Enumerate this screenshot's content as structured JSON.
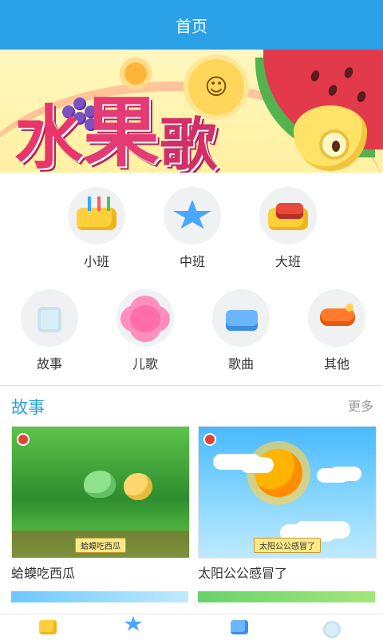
{
  "header": {
    "title": "首页"
  },
  "banner": {
    "text_parts": [
      "水",
      "果",
      "歌"
    ]
  },
  "categories": [
    {
      "label": "小班",
      "icon": "cheese-icon"
    },
    {
      "label": "中班",
      "icon": "star-icon"
    },
    {
      "label": "大班",
      "icon": "cheese-roll-icon"
    },
    {
      "label": "故事",
      "icon": "cup-icon"
    },
    {
      "label": "儿歌",
      "icon": "flower-icon"
    },
    {
      "label": "歌曲",
      "icon": "piano-icon"
    },
    {
      "label": "其他",
      "icon": "plane-icon"
    }
  ],
  "stories_section": {
    "title": "故事",
    "more": "更多"
  },
  "stories": [
    {
      "title": "蛤蟆吃西瓜",
      "caption": "蛤蟆吃西瓜"
    },
    {
      "title": "太阳公公感冒了",
      "caption": "太阳公公感冒了"
    }
  ],
  "colors": {
    "accent": "#2aa0e6",
    "tabbar_border": "#e6e6e6"
  }
}
